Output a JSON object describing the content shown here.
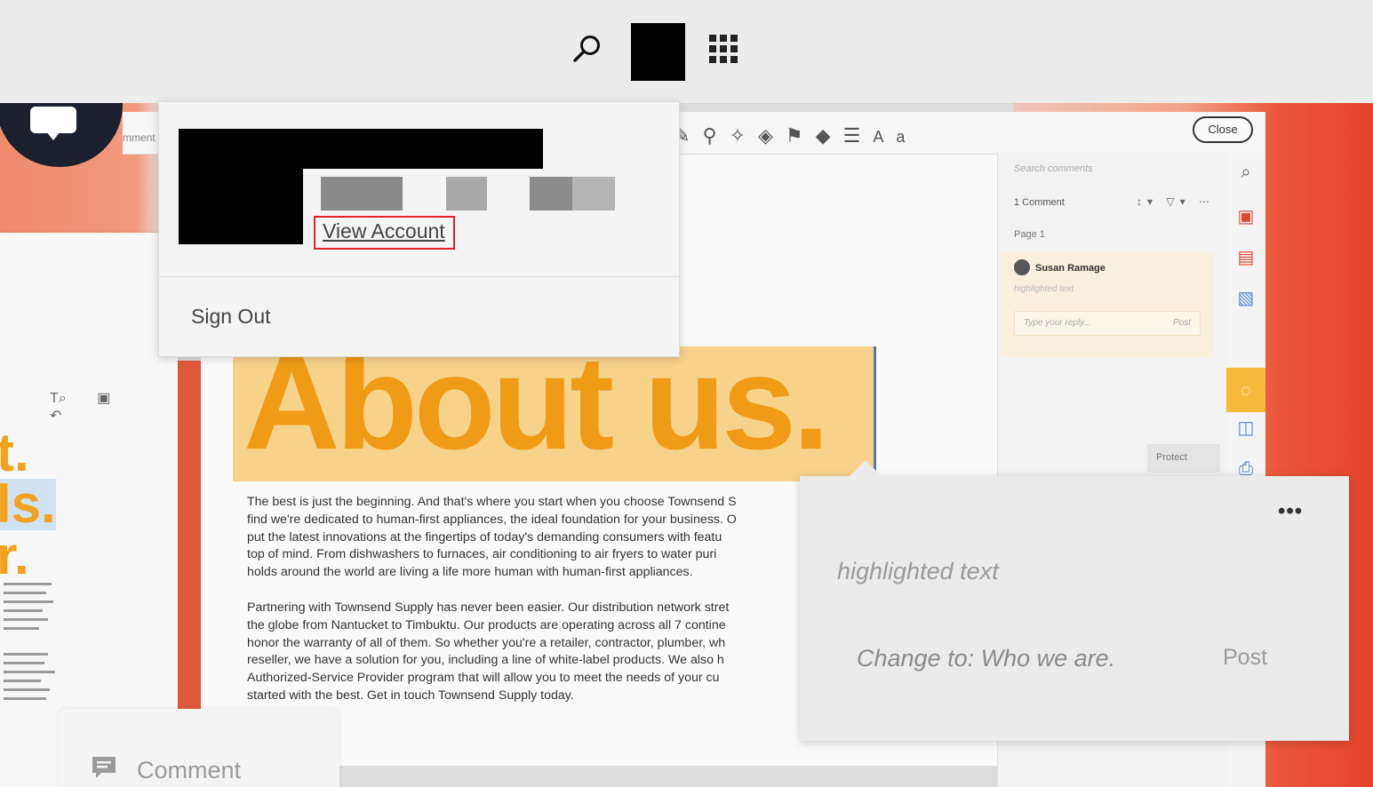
{
  "topbar": {
    "search_icon": "search-icon",
    "avatar": "avatar",
    "apps_icon": "apps-grid-icon"
  },
  "account_menu": {
    "view_account_label": "View Account",
    "sign_out_label": "Sign Out"
  },
  "document": {
    "title": "About us.",
    "paragraph_1": [
      "The best is just the beginning. And that's where you start when you choose Townsend S",
      "find we're dedicated to human-first appliances, the ideal foundation for your business. O",
      "put the latest innovations at the fingertips of today's demanding consumers with featu",
      "top of mind. From dishwashers to furnaces, air conditioning to air fryers to water puri",
      "holds around the world are living a life more human with human-first appliances."
    ],
    "paragraph_2": [
      "Partnering with Townsend Supply has never been easier. Our distribution network stret",
      "the globe from Nantucket to Timbuktu. Our products are operating across all 7 contine",
      "honor the warranty of all of them. So whether you're a retailer, contractor, plumber, wh",
      "reseller, we have a solution for you, including a line of white-label products. We also h",
      "Authorized-Service Provider program that will allow you to meet the needs of your cu",
      "started with the best. Get in touch Townsend Supply today."
    ]
  },
  "toolbar": {
    "label": "mment",
    "close_label": "Close"
  },
  "left_panel": {
    "big_text_1": "t.",
    "big_text_2": "ls.",
    "big_text_3": "r."
  },
  "comments_panel": {
    "search_placeholder": "Search comments",
    "count": "1 Comment",
    "page": "Page 1",
    "user": "Susan Ramage",
    "highlighted": "highlighted text",
    "reply_placeholder": "Type your reply...",
    "reply_post": "Post",
    "protect": "Protect"
  },
  "comment_popup": {
    "more": "•••",
    "highlighted": "highlighted text",
    "change": "Change to: Who we are.",
    "post": "Post"
  },
  "comment_tab": {
    "label": "Comment",
    "icon": "comment-icon"
  },
  "colors": {
    "accent_red": "#e3202d",
    "orange_title": "#ef9b16",
    "highlight_yellow": "#f6d28b"
  }
}
